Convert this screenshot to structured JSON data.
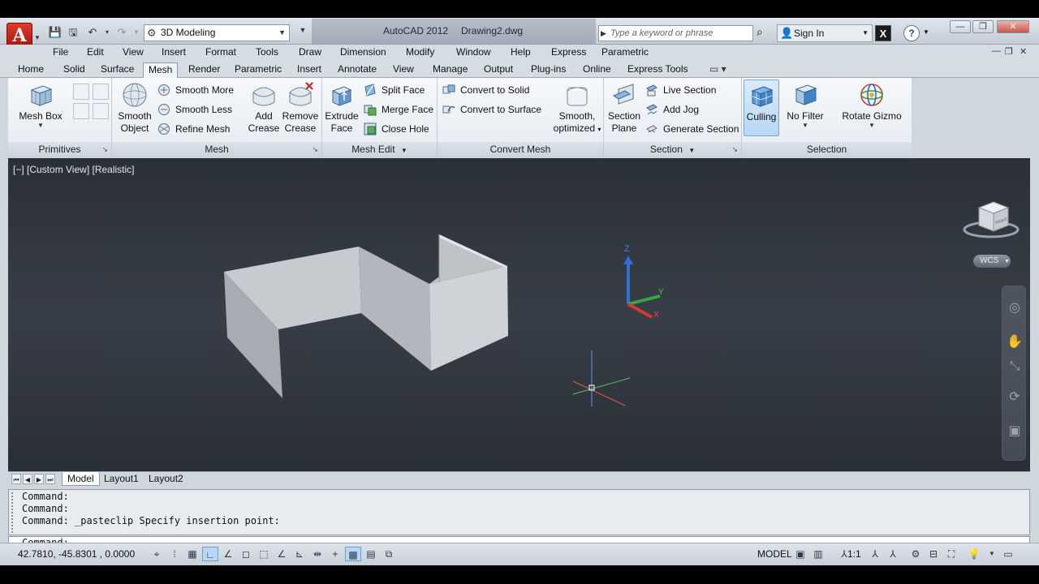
{
  "titlebar": {
    "app_title": "AutoCAD 2012",
    "file_name": "Drawing2.dwg",
    "workspace": "3D Modeling",
    "search_placeholder": "Type a keyword or phrase",
    "sign_in": "Sign In",
    "app_button": "A"
  },
  "menubar": [
    "File",
    "Edit",
    "View",
    "Insert",
    "Format",
    "Tools",
    "Draw",
    "Dimension",
    "Modify",
    "Window",
    "Help",
    "Express",
    "Parametric"
  ],
  "ribbon_tabs": [
    "Home",
    "Solid",
    "Surface",
    "Mesh",
    "Render",
    "Parametric",
    "Insert",
    "Annotate",
    "View",
    "Manage",
    "Output",
    "Plug-ins",
    "Online",
    "Express Tools"
  ],
  "active_tab": "Mesh",
  "ribbon": {
    "primitives": {
      "title": "Primitives",
      "mesh_box": "Mesh Box"
    },
    "mesh": {
      "title": "Mesh",
      "smooth_object_1": "Smooth",
      "smooth_object_2": "Object",
      "smooth_more": "Smooth More",
      "smooth_less": "Smooth Less",
      "refine_mesh": "Refine Mesh",
      "add_crease_1": "Add",
      "add_crease_2": "Crease",
      "remove_crease_1": "Remove",
      "remove_crease_2": "Crease"
    },
    "mesh_edit": {
      "title": "Mesh Edit",
      "extrude_face_1": "Extrude",
      "extrude_face_2": "Face",
      "split_face": "Split Face",
      "merge_face": "Merge Face",
      "close_hole": "Close Hole"
    },
    "convert_mesh": {
      "title": "Convert Mesh",
      "convert_to_solid": "Convert to Solid",
      "convert_to_surface": "Convert to Surface",
      "smooth_optimized_1": "Smooth,",
      "smooth_optimized_2": "optimized"
    },
    "section": {
      "title": "Section",
      "section_plane_1": "Section",
      "section_plane_2": "Plane",
      "live_section": "Live Section",
      "add_jog": "Add Jog",
      "generate_section": "Generate Section"
    },
    "selection": {
      "title": "Selection",
      "culling": "Culling",
      "no_filter": "No Filter",
      "rotate_gizmo": "Rotate Gizmo"
    }
  },
  "viewport": {
    "label": "[−] [Custom View] [Realistic]",
    "wcs": "WCS",
    "ucs_x": "X",
    "ucs_y": "Y",
    "ucs_z": "Z",
    "viewcube_face": "RIGHT"
  },
  "layout_tabs": [
    "Model",
    "Layout1",
    "Layout2"
  ],
  "command": {
    "history": [
      "Command:",
      "Command:",
      "Command: _pasteclip Specify insertion point:"
    ],
    "prompt": "Command:"
  },
  "status": {
    "coords": "42.7810,  -45.8301 , 0.0000",
    "model": "MODEL",
    "scale": "1:1"
  },
  "colors": {
    "accent": "#1f6fbf",
    "app_red": "#c8271b",
    "viewport_bg": "#323840"
  }
}
